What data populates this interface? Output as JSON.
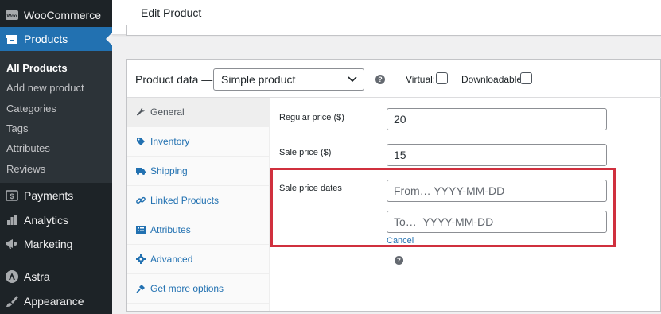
{
  "sidebar": {
    "woocommerce": {
      "label": "WooCommerce",
      "icon": "woo-icon"
    },
    "products": {
      "label": "Products",
      "icon": "products-icon"
    },
    "submenu": [
      "All Products",
      "Add new product",
      "Categories",
      "Tags",
      "Attributes",
      "Reviews"
    ],
    "payments": {
      "label": "Payments",
      "icon": "payments-icon"
    },
    "analytics": {
      "label": "Analytics",
      "icon": "analytics-icon"
    },
    "marketing": {
      "label": "Marketing",
      "icon": "megaphone-icon"
    },
    "astra": {
      "label": "Astra",
      "icon": "astra-icon"
    },
    "appearance": {
      "label": "Appearance",
      "icon": "brush-icon"
    }
  },
  "header": {
    "title": "Edit Product"
  },
  "product_data": {
    "label": "Product data —",
    "type_selected": "Simple product",
    "virtual_label": "Virtual:",
    "downloadable_label": "Downloadable:",
    "help": "?",
    "tabs": [
      "General",
      "Inventory",
      "Shipping",
      "Linked Products",
      "Attributes",
      "Advanced",
      "Get more options"
    ],
    "fields": {
      "regular_price_label": "Regular price ($)",
      "regular_price_value": "20",
      "sale_price_label": "Sale price ($)",
      "sale_price_value": "15",
      "sale_dates_label": "Sale price dates",
      "date_from_placeholder": "From… YYYY-MM-DD",
      "date_to_placeholder": "To…  YYYY-MM-DD",
      "cancel": "Cancel"
    }
  },
  "colors": {
    "sidebar_bg": "#1d2327",
    "accent": "#2271b1",
    "highlight": "#d0303e"
  }
}
